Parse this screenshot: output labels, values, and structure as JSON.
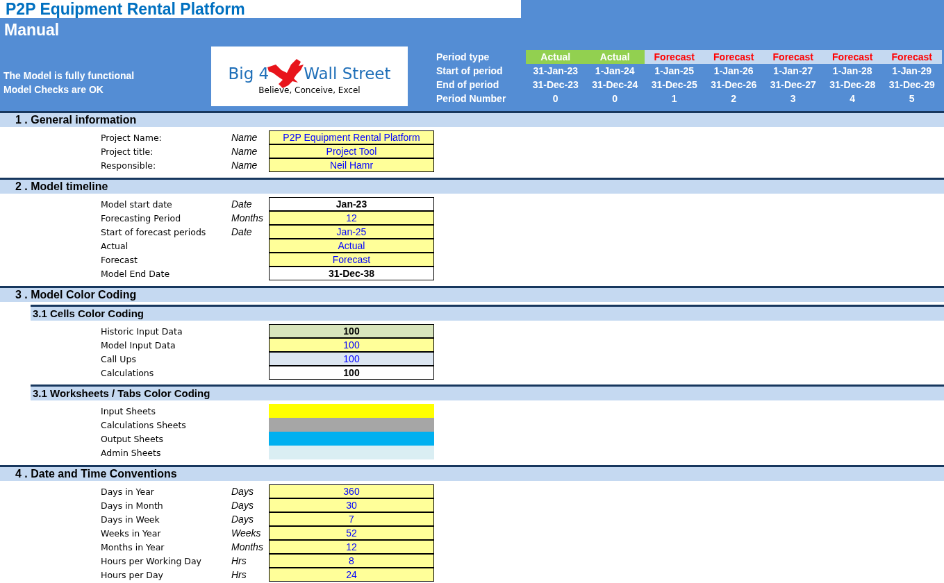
{
  "title": "P2P Equipment Rental Platform",
  "subtitle": "Manual",
  "status_lines": [
    "The Model is fully functional",
    "Model Checks are OK"
  ],
  "logo": {
    "left_text": "Big 4",
    "right_text": "Wall Street",
    "tagline": "Believe, Conceive, Excel"
  },
  "period_labels": [
    "Period type",
    "Start of period",
    "End of period",
    "Period Number"
  ],
  "periods": [
    {
      "type": "Actual",
      "kind": "actual",
      "start": "31-Jan-23",
      "end": "31-Dec-23",
      "number": "0"
    },
    {
      "type": "Actual",
      "kind": "actual",
      "start": "1-Jan-24",
      "end": "31-Dec-24",
      "number": "0"
    },
    {
      "type": "Forecast",
      "kind": "forecast",
      "start": "1-Jan-25",
      "end": "31-Dec-25",
      "number": "1"
    },
    {
      "type": "Forecast",
      "kind": "forecast",
      "start": "1-Jan-26",
      "end": "31-Dec-26",
      "number": "2"
    },
    {
      "type": "Forecast",
      "kind": "forecast",
      "start": "1-Jan-27",
      "end": "31-Dec-27",
      "number": "3"
    },
    {
      "type": "Forecast",
      "kind": "forecast",
      "start": "1-Jan-28",
      "end": "31-Dec-28",
      "number": "4"
    },
    {
      "type": "Forecast",
      "kind": "forecast",
      "start": "1-Jan-29",
      "end": "31-Dec-29",
      "number": "5"
    }
  ],
  "sections": [
    {
      "title": "1 . General information",
      "rows": [
        {
          "label": "Project Name:",
          "unit": "Name",
          "kind": "input",
          "value": "P2P Equipment Rental Platform"
        },
        {
          "label": "Project title:",
          "unit": "Name",
          "kind": "input",
          "value": "Project Tool"
        },
        {
          "label": "Responsible:",
          "unit": "Name",
          "kind": "input",
          "value": "Neil Hamr"
        }
      ]
    },
    {
      "title": "2 . Model timeline",
      "rows": [
        {
          "label": "Model start date",
          "unit": "Date",
          "kind": "calc",
          "value": "Jan-23"
        },
        {
          "label": "Forecasting Period",
          "unit": "Months",
          "kind": "input",
          "value": "12"
        },
        {
          "label": "Start of forecast periods",
          "unit": "Date",
          "kind": "input",
          "value": "Jan-25"
        },
        {
          "label": "Actual",
          "kind": "input",
          "value": "Actual"
        },
        {
          "label": "Forecast",
          "kind": "input",
          "value": "Forecast"
        },
        {
          "label": "Model End Date",
          "kind": "calc",
          "value": "31-Dec-38"
        }
      ]
    },
    {
      "title": "3 . Model Color Coding",
      "subsections": [
        {
          "title": "3.1 Cells Color Coding",
          "rows": [
            {
              "label": "Historic Input Data",
              "kind": "historic",
              "value": "100"
            },
            {
              "label": "Model Input Data",
              "kind": "input",
              "value": "100"
            },
            {
              "label": "Call Ups",
              "kind": "callup",
              "value": "100"
            },
            {
              "label": "Calculations",
              "kind": "calc",
              "value": "100"
            }
          ]
        },
        {
          "title": "3.1 Worksheets / Tabs Color Coding",
          "rows": [
            {
              "label": "Input Sheets",
              "kind": "swatch",
              "color": "#ffff00"
            },
            {
              "label": "Calculations Sheets",
              "kind": "swatch",
              "color": "#a6a6a6"
            },
            {
              "label": "Output Sheets",
              "kind": "swatch",
              "color": "#00b0f0"
            },
            {
              "label": "Admin Sheets",
              "kind": "swatch",
              "color": "#daeef3"
            }
          ]
        }
      ]
    },
    {
      "title": "4 . Date and Time Conventions",
      "rows": [
        {
          "label": "Days in Year",
          "unit": "Days",
          "kind": "input",
          "value": "360"
        },
        {
          "label": "Days in Month",
          "unit": "Days",
          "kind": "input",
          "value": "30"
        },
        {
          "label": "Days in Week",
          "unit": "Days",
          "kind": "input",
          "value": "7"
        },
        {
          "label": "Weeks in Year",
          "unit": "Weeks",
          "kind": "input",
          "value": "52"
        },
        {
          "label": "Months in Year",
          "unit": "Months",
          "kind": "input",
          "value": "12"
        },
        {
          "label": "Hours per Working Day",
          "unit": "Hrs",
          "kind": "input",
          "value": "8"
        },
        {
          "label": "Hours per Day",
          "unit": "Hrs",
          "kind": "input",
          "value": "24"
        }
      ]
    }
  ]
}
